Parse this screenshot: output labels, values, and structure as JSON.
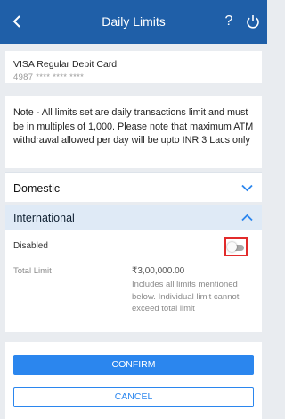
{
  "header": {
    "title": "Daily Limits",
    "help_label": "?",
    "background_color": "#1f5fa8"
  },
  "account": {
    "card_name": "VISA Regular Debit Card",
    "card_number": "4987 **** **** ****"
  },
  "note": {
    "text": "Note - All limits set are daily transactions limit and must be in multiples of 1,000. Please note that maximum ATM withdrawal allowed per day will be upto INR 3 Lacs only"
  },
  "sections": {
    "domestic": {
      "label": "Domestic",
      "expanded": false
    },
    "international": {
      "label": "International",
      "expanded": true,
      "status_label": "Disabled",
      "toggle_on": false,
      "total_limit_label": "Total Limit",
      "total_limit_amount": "₹3,00,000.00",
      "total_limit_description": "Includes all limits mentioned below. Individual limit cannot exceed total limit"
    }
  },
  "actions": {
    "confirm_label": "CONFIRM",
    "cancel_label": "CANCEL",
    "accent_color": "#2b86ee"
  }
}
